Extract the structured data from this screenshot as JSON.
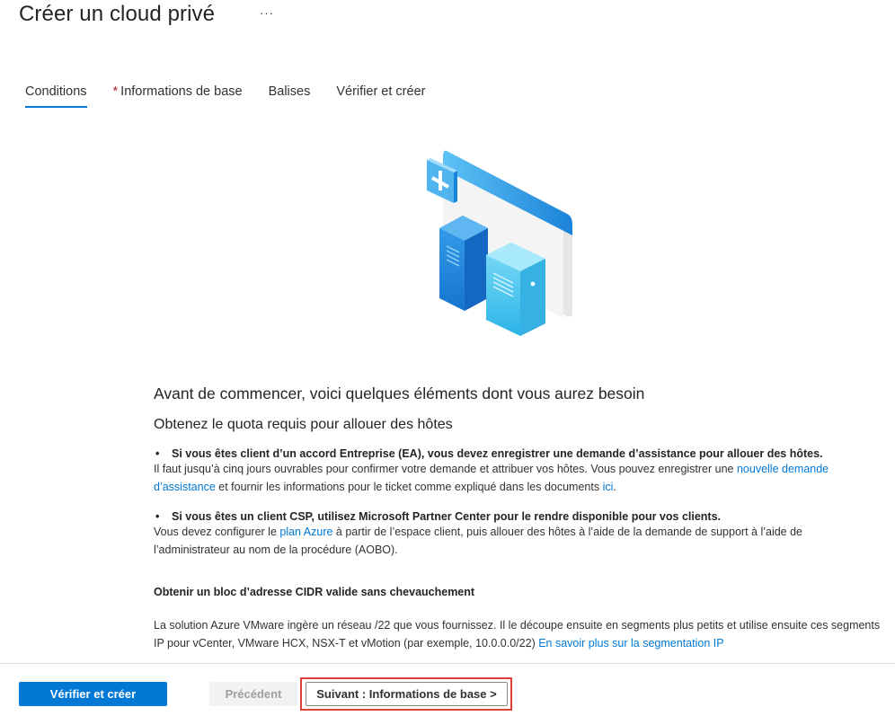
{
  "header": {
    "title": "Créer un cloud privé",
    "more_label": "···"
  },
  "tabs": [
    {
      "label": "Conditions",
      "active": true
    },
    {
      "label": "Informations de base",
      "required_marker": "*"
    },
    {
      "label": "Balises"
    },
    {
      "label": "Vérifier et créer"
    }
  ],
  "content": {
    "heading": "Avant de commencer, voici quelques éléments dont vous aurez besoin",
    "subheading": "Obtenez le quota requis pour allouer des hôtes",
    "bullet1": {
      "head": "Si vous êtes client d’un accord Entreprise (EA), vous devez enregistrer une demande d’assistance pour allouer des hôtes.",
      "text_a": "Il faut jusqu’à cinq jours ouvrables pour confirmer votre demande et attribuer vos hôtes. Vous pouvez enregistrer une ",
      "link_a": "nouvelle demande d’assistance",
      "text_b": " et fournir les informations pour le ticket comme expliqué dans les documents ",
      "link_b": "ici",
      "text_c": "."
    },
    "bullet2": {
      "head": "Si vous êtes un client CSP, utilisez Microsoft Partner Center pour le rendre disponible pour vos clients.",
      "text_a": "Vous devez configurer le ",
      "link_a": "plan Azure",
      "text_b": " à partir de l’espace client, puis allouer des hôtes à l’aide de la demande de support à l’aide de l’administrateur au nom de la procédure (AOBO)."
    },
    "cidr": {
      "head": "Obtenir un bloc d’adresse CIDR valide sans chevauchement",
      "text": "La solution Azure VMware ingère un réseau /22 que vous fournissez. Il le découpe ensuite en segments plus petits et utilise ensuite ces segments IP pour vCenter, VMware HCX, NSX-T et vMotion (par exemple, 10.0.0.0/22) ",
      "link": "En savoir plus sur la segmentation IP"
    }
  },
  "footer": {
    "review_create_label": "Vérifier et créer",
    "previous_label": "Précédent",
    "next_label": "Suivant : Informations de base >"
  },
  "colors": {
    "accent": "#0078d4",
    "highlight": "#e0403a",
    "required": "#a4262c"
  }
}
